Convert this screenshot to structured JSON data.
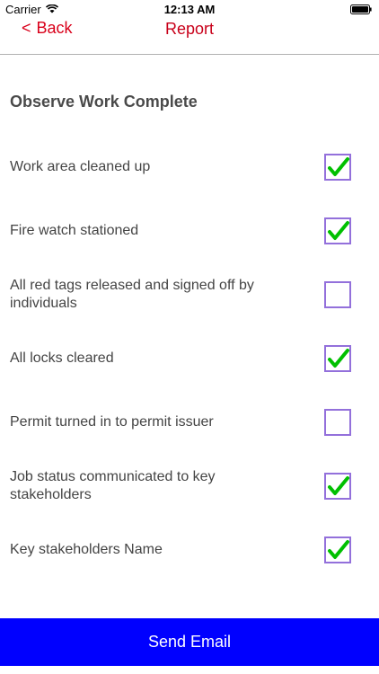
{
  "status_bar": {
    "carrier": "Carrier",
    "time": "12:13 AM"
  },
  "nav": {
    "back_chevron": "<",
    "back_label": "Back",
    "title": "Report"
  },
  "section_title": "Observe Work Complete",
  "checklist": [
    {
      "label": "Work area cleaned up",
      "checked": true
    },
    {
      "label": "Fire watch stationed",
      "checked": true
    },
    {
      "label": "All red tags released and signed off by individuals",
      "checked": false
    },
    {
      "label": "All locks cleared",
      "checked": true
    },
    {
      "label": "Permit turned in to permit issuer",
      "checked": false
    },
    {
      "label": "Job status communicated to key stakeholders",
      "checked": true
    },
    {
      "label": "Key stakeholders Name",
      "checked": true
    }
  ],
  "send_button_label": "Send Email",
  "colors": {
    "nav_red": "#d9001a",
    "checkbox_border": "#9370db",
    "checkmark_green": "#00c000",
    "button_blue": "#0000ff"
  }
}
